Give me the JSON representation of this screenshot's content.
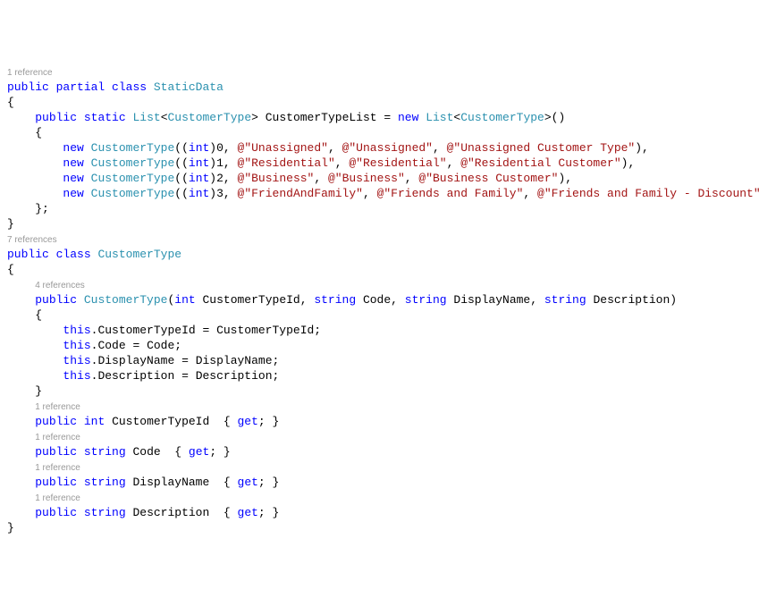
{
  "codelens": {
    "ref1": "1 reference",
    "ref7": "7 references",
    "ref4": "4 references"
  },
  "kw": {
    "public": "public",
    "partial": "partial",
    "class": "class",
    "static": "static",
    "new": "new",
    "int": "int",
    "string": "string",
    "this": "this",
    "get": "get"
  },
  "types": {
    "StaticData": "StaticData",
    "List": "List",
    "CustomerType": "CustomerType"
  },
  "ids": {
    "CustomerTypeList": "CustomerTypeList",
    "CustomerTypeId": "CustomerTypeId",
    "Code": "Code",
    "DisplayName": "DisplayName",
    "Description": "Description"
  },
  "nums": {
    "0": "0",
    "1": "1",
    "2": "2",
    "3": "3"
  },
  "strs": {
    "unassigned": "@\"Unassigned\"",
    "unassignedDesc": "@\"Unassigned Customer Type\"",
    "residential": "@\"Residential\"",
    "residentialDesc": "@\"Residential Customer\"",
    "business": "@\"Business\"",
    "businessDesc": "@\"Business Customer\"",
    "faf": "@\"FriendAndFamily\"",
    "fafDisp": "@\"Friends and Family\"",
    "fafDesc": "@\"Friends and Family - Discount\""
  },
  "p": {
    "obrace": "{",
    "cbrace": "}",
    "oparen": "(",
    "cparen": ")",
    "lt": "<",
    "gt": ">",
    "eq": " = ",
    "comma": ", ",
    "commaNL": ",",
    "semicolon": ";",
    "dot": ".",
    "getblock": " { ",
    "getsemicolon": "; }"
  }
}
